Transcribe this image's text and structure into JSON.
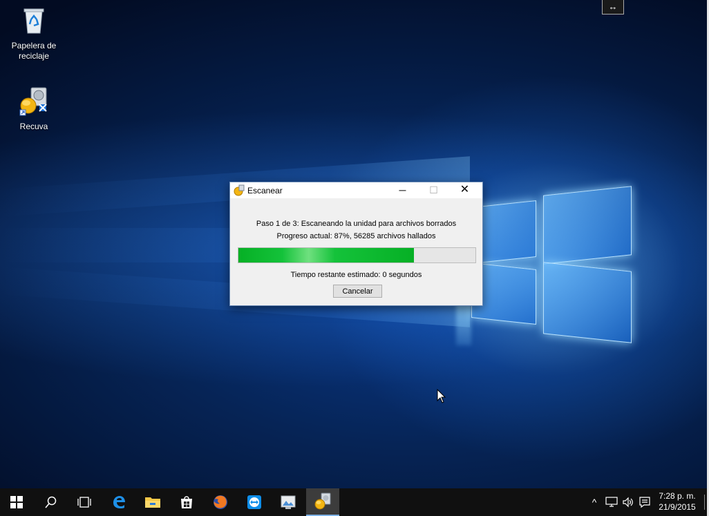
{
  "desktop": {
    "icons": [
      {
        "label": "Papelera de reciclaje",
        "icon": "recycle-bin-icon"
      },
      {
        "label": "Recuva",
        "icon": "recuva-icon"
      }
    ]
  },
  "dialog": {
    "title": "Escanear",
    "minimize": "─",
    "maximize": "☐",
    "close": "✕",
    "step_text": "Paso 1 de 3: Escaneando la unidad para archivos borrados",
    "progress_text": "Progreso actual: 87%, 56285 archivos hallados",
    "progress_value": 0.74,
    "remaining_text": "Tiempo restante estimado: 0 segundos",
    "cancel_label": "Cancelar"
  },
  "topbar": {
    "resize_glyph": "↔"
  },
  "taskbar": {
    "items": [
      {
        "icon": "windows-start-icon"
      },
      {
        "icon": "search-icon"
      },
      {
        "icon": "task-view-icon"
      },
      {
        "icon": "edge-browser-icon"
      },
      {
        "icon": "file-explorer-icon"
      },
      {
        "icon": "store-icon"
      },
      {
        "icon": "firefox-icon"
      },
      {
        "icon": "teamviewer-icon"
      },
      {
        "icon": "image-viewer-icon"
      },
      {
        "icon": "recuva-taskbar-icon"
      }
    ],
    "tray": {
      "chevron": "^",
      "time": "7:28 p. m.",
      "date": "21/9/2015"
    }
  },
  "colors": {
    "progress_green": "#06b025",
    "accent_blue": "#0078d7",
    "taskbar_bg": "#101010"
  }
}
